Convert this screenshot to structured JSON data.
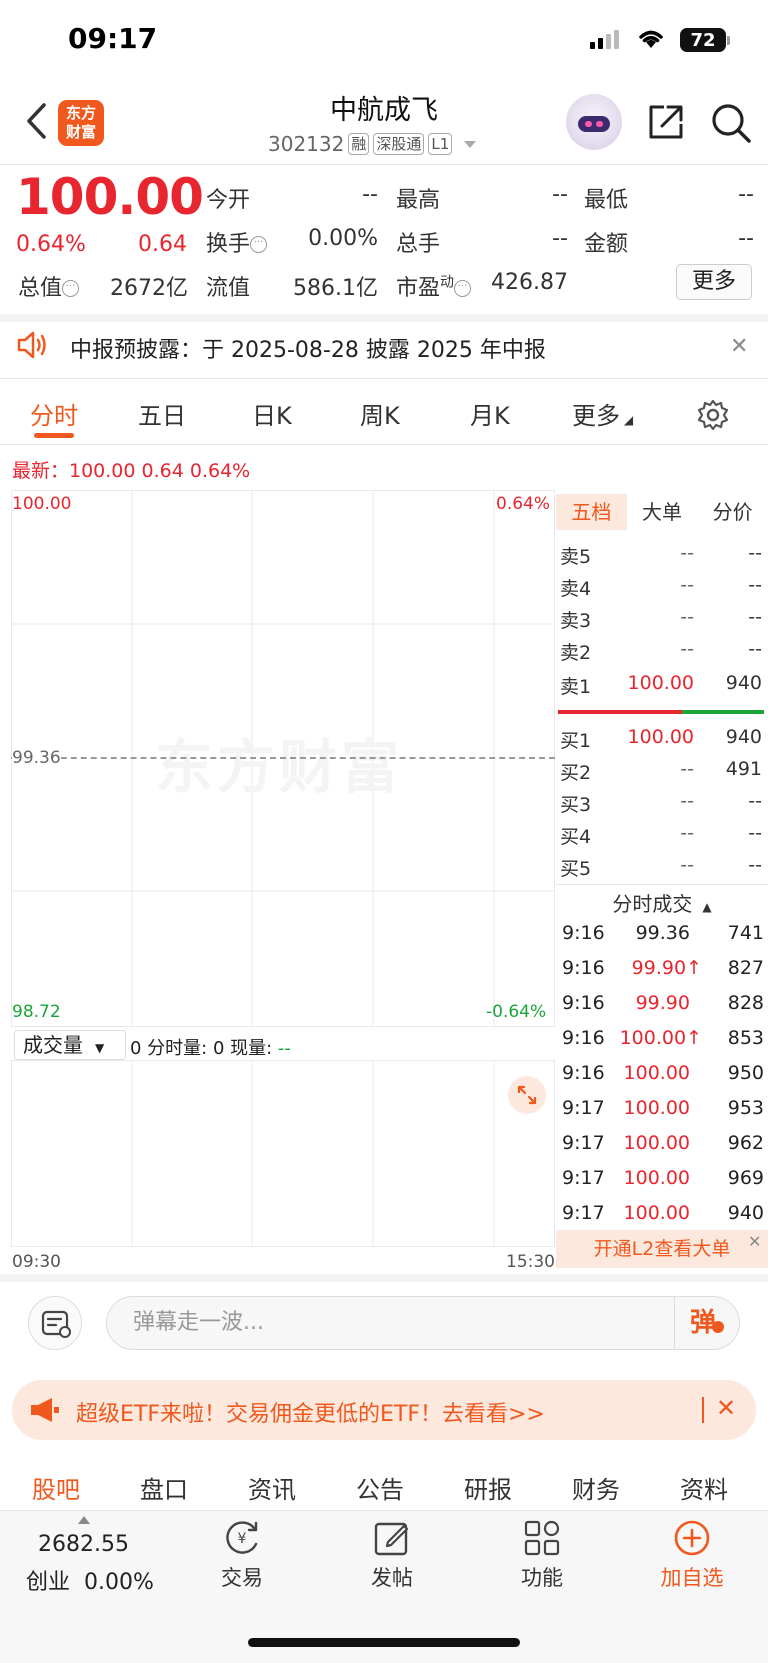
{
  "status_bar": {
    "time": "09:17",
    "battery": "72"
  },
  "header": {
    "logo_line1": "东方",
    "logo_line2": "财富",
    "stock_name": "中航成飞",
    "stock_code": "302132",
    "tags": [
      "融",
      "深股通",
      "L1"
    ]
  },
  "quote": {
    "price": "100.00",
    "change_pct": "0.64%",
    "change": "0.64",
    "fields": {
      "open_label": "今开",
      "open_value": "--",
      "high_label": "最高",
      "high_value": "--",
      "low_label": "最低",
      "low_value": "--",
      "turnover_label": "换手",
      "turnover_value": "0.00%",
      "volume_label": "总手",
      "volume_value": "--",
      "amount_label": "金额",
      "amount_value": "--",
      "mcap_label": "总值",
      "mcap_value": "2672亿",
      "float_label": "流值",
      "float_value": "586.1亿",
      "pe_label": "市盈",
      "pe_sup": "动",
      "pe_value": "426.87"
    },
    "more_button": "更多"
  },
  "notice": {
    "text": "中报预披露：于 2025-08-28 披露 2025 年中报"
  },
  "chart_tabs": [
    "分时",
    "五日",
    "日K",
    "周K",
    "月K",
    "更多"
  ],
  "chart": {
    "latest_line": "最新：100.00  0.64  0.64%",
    "y_top": "100.00",
    "y_mid": "99.36",
    "y_bottom": "98.72",
    "pct_top": "0.64%",
    "pct_bottom": "-0.64%",
    "x_start": "09:30",
    "x_end": "15:30",
    "watermark": "东方财富",
    "volume_select": "成交量",
    "volume_text_prefix": "0 分时量: 0 现量: ",
    "volume_text_value": "--"
  },
  "order_book": {
    "tabs": [
      "五档",
      "大单",
      "分价"
    ],
    "asks": [
      {
        "label": "卖5",
        "price": "--",
        "vol": "--"
      },
      {
        "label": "卖4",
        "price": "--",
        "vol": "--"
      },
      {
        "label": "卖3",
        "price": "--",
        "vol": "--"
      },
      {
        "label": "卖2",
        "price": "--",
        "vol": "--"
      },
      {
        "label": "卖1",
        "price": "100.00",
        "vol": "940"
      }
    ],
    "bids": [
      {
        "label": "买1",
        "price": "100.00",
        "vol": "940"
      },
      {
        "label": "买2",
        "price": "--",
        "vol": "491"
      },
      {
        "label": "买3",
        "price": "--",
        "vol": "--"
      },
      {
        "label": "买4",
        "price": "--",
        "vol": "--"
      },
      {
        "label": "买5",
        "price": "--",
        "vol": "--"
      }
    ],
    "ticks_title": "分时成交",
    "ticks": [
      {
        "time": "9:16",
        "price": "99.36",
        "vol": "741"
      },
      {
        "time": "9:16",
        "price": "99.90↑",
        "vol": "827"
      },
      {
        "time": "9:16",
        "price": "99.90",
        "vol": "828"
      },
      {
        "time": "9:16",
        "price": "100.00↑",
        "vol": "853"
      },
      {
        "time": "9:16",
        "price": "100.00",
        "vol": "950"
      },
      {
        "time": "9:17",
        "price": "100.00",
        "vol": "953"
      },
      {
        "time": "9:17",
        "price": "100.00",
        "vol": "962"
      },
      {
        "time": "9:17",
        "price": "100.00",
        "vol": "969"
      },
      {
        "time": "9:17",
        "price": "100.00",
        "vol": "940"
      }
    ],
    "l2_banner": "开通L2查看大单"
  },
  "danmaku": {
    "placeholder": "弹幕走一波...",
    "button": "弹"
  },
  "etf_banner": {
    "text": "超级ETF来啦！交易佣金更低的ETF！去看看>>"
  },
  "section_tabs": [
    "股吧",
    "盘口",
    "资讯",
    "公告",
    "研报",
    "财务",
    "资料"
  ],
  "bottom_nav": {
    "index_value": "2682.55",
    "index_name": "创业",
    "index_change": "0.00%",
    "items": [
      "交易",
      "发帖",
      "功能",
      "加自选"
    ]
  },
  "colors": {
    "accent": "#f0581d",
    "up": "#e8262f",
    "down": "#1aa53b"
  }
}
